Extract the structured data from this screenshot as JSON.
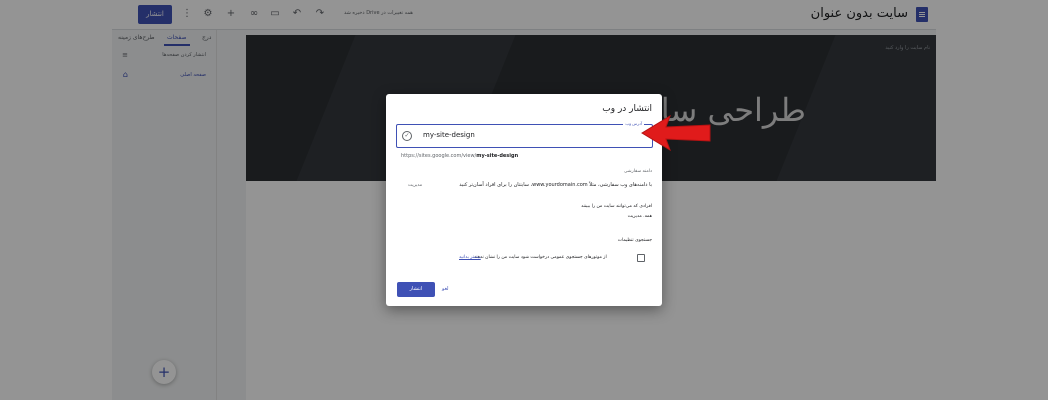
{
  "colors": {
    "accent": "#3f51b5",
    "arrow": "#e01b1b",
    "hero_bg": "#2c2f33",
    "overlay": "rgba(0,0,0,0.42)"
  },
  "topbar": {
    "site_title": "سایت بدون عنوان",
    "drive_note": "همه تغییرات در Drive ذخیره شد",
    "publish_label": "انتشار",
    "icons": [
      "more-vert-icon",
      "settings-icon",
      "add-person-icon",
      "link-icon",
      "preview-icon",
      "undo-icon",
      "redo-icon"
    ]
  },
  "sidebar": {
    "tabs": [
      {
        "label": "درج"
      },
      {
        "label": "صفحات",
        "active": true
      },
      {
        "label": "طرح‌های زمینه"
      }
    ],
    "filter_label": "انتشار کردن صفحه‌ها",
    "home_label": "صفحه اصلی"
  },
  "hero": {
    "small_text": "نام سایت را وارد کنید",
    "title": "طراحی سایت"
  },
  "dialog": {
    "title": "انتشار در وب",
    "address_label": "آدرس وب",
    "address_value": "my-site-design",
    "url_prefix": "https://sites.google.com/view/",
    "url_slug": "my-site-design",
    "custom_domain_heading": "دامنه سفارشی",
    "custom_domain_text": "با دامنه‌های وب سفارشی، مثلاً www.yourdomain.com، سایتتان را برای افراد آسان‌تر کنید",
    "manage_link": "مدیریت",
    "viewers_heading": "افرادی که می‌توانند سایت من را ببینند",
    "viewers_value": "همه. مدیریت",
    "search_heading": "جستجوی تنظیمات",
    "search_text": "از موتورهای جستجوی عمومی درخواست شود سایت من را نشان ندهند",
    "learn_more": "بیشتر بدانید",
    "publish_button": "انتشار",
    "cancel_button": "لغو"
  }
}
